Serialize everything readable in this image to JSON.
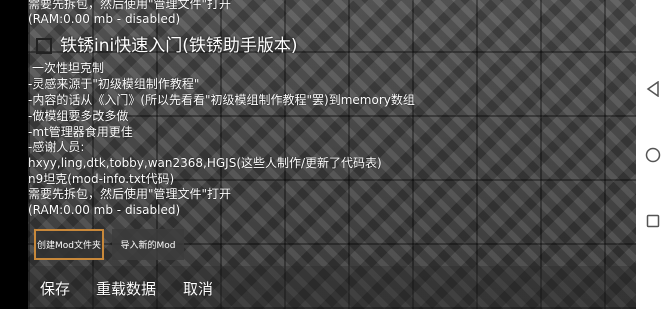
{
  "content": {
    "lines_top": [
      "需要先拆包，然后使用\"管理文件\"打开",
      " (RAM:0.00 mb - disabled)"
    ],
    "title": "铁锈ini快速入门(铁锈助手版本)",
    "description_lines": [
      "一次性坦克制",
      "-灵感来源于\"初级模组制作教程\"",
      "-内容的话从《入门》(所以先看看\"初级模组制作教程\"罢)到memory数组",
      "-做模组要多改多做",
      "-mt管理器食用更佳",
      "-感谢人员:",
      "hxyy,ling,dtk,tobby,wan2368,HGJS(这些人制作/更新了代码表)",
      "n9坦克(mod-info.txt代码)",
      "需要先拆包，然后使用\"管理文件\"打开",
      " (RAM:0.00 mb - disabled)"
    ]
  },
  "buttons": {
    "create_mod_folder": "创建Mod文件夹",
    "import_mod": "导入新的Mod",
    "save": "保存",
    "reload": "重载数据",
    "cancel": "取消"
  },
  "colors": {
    "selected_border": "#c8883a",
    "nav_background": "#ffffff",
    "text": "#ffffff"
  },
  "icons": {
    "nav_back": "triangle-back-icon",
    "nav_home": "circle-home-icon",
    "nav_recent": "square-recent-icon"
  }
}
